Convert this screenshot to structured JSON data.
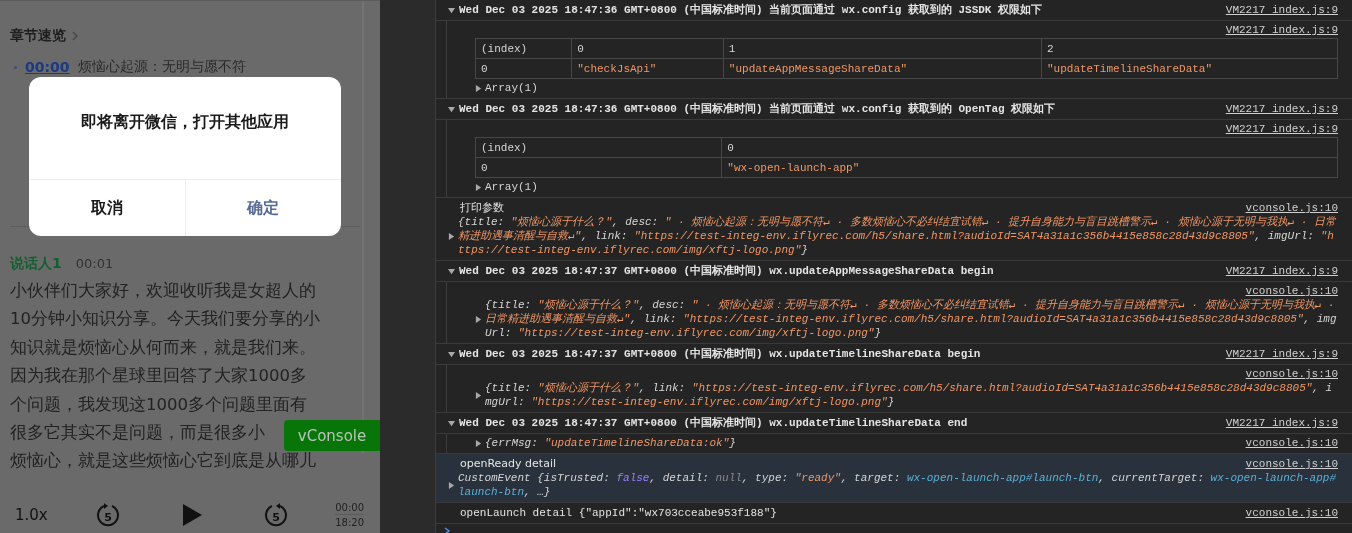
{
  "article": {
    "chapters_title": "章节速览",
    "chapters": [
      {
        "time": "00:00",
        "title": "烦恼心起源：无明与愿不符"
      }
    ],
    "speaker": {
      "name": "说话人1",
      "time": "00:01"
    },
    "transcript_lines": [
      "小伙伴们大家好，欢迎收听我是女超人的",
      "10分钟小知识分享。今天我们要分享的小",
      "知识就是烦恼心从何而来，就是我们来。",
      "因为我在那个星球里回答了大家1000多",
      "个问题，我发现这1000多个问题里面有",
      "很多它其实不是问题，而是很多小",
      "烦恼心，就是这些烦恼心它到底是从哪儿"
    ],
    "player": {
      "speed": "1.0x",
      "rewind": "5",
      "forward": "5",
      "current": "00:00",
      "total": "18:20"
    }
  },
  "dialog": {
    "title": "即将离开微信，打开其他应用",
    "buttons": [
      {
        "label": "取消",
        "kind": "cancel"
      },
      {
        "label": "确定",
        "kind": "confirm"
      }
    ]
  },
  "vconsole_button": "vConsole",
  "console": {
    "entries": [
      {
        "kind": "group",
        "expanded": true,
        "title": "Wed Dec 03 2025 18:47:36 GMT+0800 (中国标准时间) 当前页面通过 wx.config 获取到的 JSSDK 权限如下",
        "source": "VM2217 index.js:9",
        "body": {
          "source": "VM2217 index.js:9",
          "table": {
            "columns": [
              "(index)",
              "0",
              "1",
              "2"
            ],
            "rows": [
              [
                "0",
                "\"checkJsApi\"",
                "\"updateAppMessageShareData\"",
                "\"updateTimelineShareData\""
              ]
            ]
          },
          "summary": "Array(1)"
        }
      },
      {
        "kind": "group",
        "expanded": true,
        "title": "Wed Dec 03 2025 18:47:36 GMT+0800 (中国标准时间) 当前页面通过 wx.config 获取到的 OpenTag 权限如下",
        "source": "VM2217 index.js:9",
        "body": {
          "source": "VM2217 index.js:9",
          "table": {
            "columns": [
              "(index)",
              "0"
            ],
            "rows": [
              [
                "0",
                "\"wx-open-launch-app\""
              ]
            ]
          },
          "summary": "Array(1)"
        }
      },
      {
        "kind": "log",
        "highlighted": false,
        "label": "打印参数",
        "source": "vconsole.js:10",
        "object": [
          {
            "text": "{title: ",
            "kind": "key"
          },
          {
            "text": "\"烦恼心源于什么？\"",
            "kind": "string"
          },
          {
            "text": ", desc: ",
            "kind": "key"
          },
          {
            "text": "\" · 烦恼心起源：无明与愿不符↵ · 多数烦恼心不必纠结宜试错↵ · 提升自身能力与盲目跳槽警示↵ · 烦恼心源于无明与我执↵ · 日常精进助遇事清醒与自救↵\"",
            "kind": "string"
          },
          {
            "text": ", link: ",
            "kind": "key"
          },
          {
            "text": "\"https://test-integ-env.iflyrec.com/h5/share.html?audioId=SAT4a31a1c356b4415e858c28d43d9c8805\"",
            "kind": "string"
          },
          {
            "text": ", imgUrl: ",
            "kind": "key"
          },
          {
            "text": "\"https://test-integ-env.iflyrec.com/img/xftj-logo.png\"",
            "kind": "string"
          },
          {
            "text": "}",
            "kind": "key"
          }
        ]
      },
      {
        "kind": "group",
        "expanded": true,
        "title": "Wed Dec 03 2025 18:47:37 GMT+0800 (中国标准时间) wx.updateAppMessageShareData begin",
        "source": "VM2217 index.js:9",
        "body": {
          "source": "vconsole.js:10",
          "object": [
            {
              "text": "{title: ",
              "kind": "key"
            },
            {
              "text": "\"烦恼心源于什么？\"",
              "kind": "string"
            },
            {
              "text": ", desc: ",
              "kind": "key"
            },
            {
              "text": "\" · 烦恼心起源：无明与愿不符↵ · 多数烦恼心不必纠结宜试错↵ · 提升自身能力与盲目跳槽警示↵ · 烦恼心源于无明与我执↵ · 日常精进助遇事清醒与自救↵\"",
              "kind": "string"
            },
            {
              "text": ", link: ",
              "kind": "key"
            },
            {
              "text": "\"https://test-integ-env.iflyrec.com/h5/share.html?audioId=SAT4a31a1c356b4415e858c28d43d9c8805\"",
              "kind": "string"
            },
            {
              "text": ", imgUrl: ",
              "kind": "key"
            },
            {
              "text": "\"https://test-integ-env.iflyrec.com/img/xftj-logo.png\"",
              "kind": "string"
            },
            {
              "text": "}",
              "kind": "key"
            }
          ]
        }
      },
      {
        "kind": "group",
        "expanded": true,
        "title": "Wed Dec 03 2025 18:47:37 GMT+0800 (中国标准时间) wx.updateTimelineShareData begin",
        "source": "VM2217 index.js:9",
        "body": {
          "source": "vconsole.js:10",
          "object": [
            {
              "text": "{title: ",
              "kind": "key"
            },
            {
              "text": "\"烦恼心源于什么？\"",
              "kind": "string"
            },
            {
              "text": ", link: ",
              "kind": "key"
            },
            {
              "text": "\"https://test-integ-env.iflyrec.com/h5/share.html?audioId=SAT4a31a1c356b4415e858c28d43d9c8805\"",
              "kind": "string"
            },
            {
              "text": ", imgUrl: ",
              "kind": "key"
            },
            {
              "text": "\"https://test-integ-env.iflyrec.com/img/xftj-logo.png\"",
              "kind": "string"
            },
            {
              "text": "}",
              "kind": "key"
            }
          ]
        }
      },
      {
        "kind": "group",
        "expanded": true,
        "title": "Wed Dec 03 2025 18:47:37 GMT+0800 (中国标准时间) wx.updateTimelineShareData end",
        "source": "VM2217 index.js:9",
        "body": {
          "source_inline": "vconsole.js:10",
          "object": [
            {
              "text": "{errMsg: ",
              "kind": "key"
            },
            {
              "text": "\"updateTimelineShareData:ok\"",
              "kind": "string"
            },
            {
              "text": "}",
              "kind": "key"
            }
          ]
        }
      },
      {
        "kind": "log",
        "highlighted": true,
        "label": "openReady detail",
        "source": "vconsole.js:10",
        "object": [
          {
            "text": "CustomEvent {isTrusted: ",
            "kind": "key"
          },
          {
            "text": "false",
            "kind": "keyword"
          },
          {
            "text": ", detail: ",
            "kind": "key"
          },
          {
            "text": "null",
            "kind": "null"
          },
          {
            "text": ", type: ",
            "kind": "key"
          },
          {
            "text": "\"ready\"",
            "kind": "string"
          },
          {
            "text": ", target: ",
            "kind": "key"
          },
          {
            "text": "wx-open-launch-app#launch-btn",
            "kind": "node"
          },
          {
            "text": ", currentTarget: ",
            "kind": "key"
          },
          {
            "text": "wx-open-launch-app#launch-btn",
            "kind": "node"
          },
          {
            "text": ", …}",
            "kind": "key"
          }
        ]
      },
      {
        "kind": "log",
        "highlighted": false,
        "label": "openLaunch detail {\"appId\":\"wx703cceabe953f188\"}",
        "source": "vconsole.js:10"
      }
    ]
  }
}
